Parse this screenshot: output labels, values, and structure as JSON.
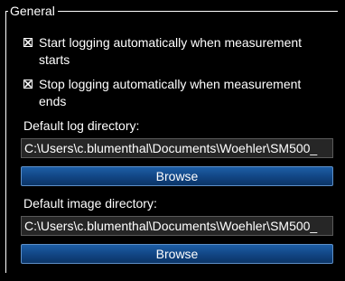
{
  "group": {
    "title": "General"
  },
  "options": {
    "start_logging": {
      "checked": true,
      "label_line1": "Start logging automatically when measurement",
      "label_line2": "starts"
    },
    "stop_logging": {
      "checked": true,
      "label_line1": "Stop logging automatically when measurement",
      "label_line2": "ends"
    }
  },
  "log_directory": {
    "label": "Default log directory:",
    "value": "C:\\Users\\c.blumenthal\\Documents\\Woehler\\SM500_",
    "button_label": "Browse"
  },
  "image_directory": {
    "label": "Default image directory:",
    "value": "C:\\Users\\c.blumenthal\\Documents\\Woehler\\SM500_",
    "button_label": "Browse"
  },
  "colors": {
    "background": "#000000",
    "text": "#ffffff",
    "button": "#124786",
    "button_border": "#5d8fc7",
    "field_background": "#262626"
  }
}
